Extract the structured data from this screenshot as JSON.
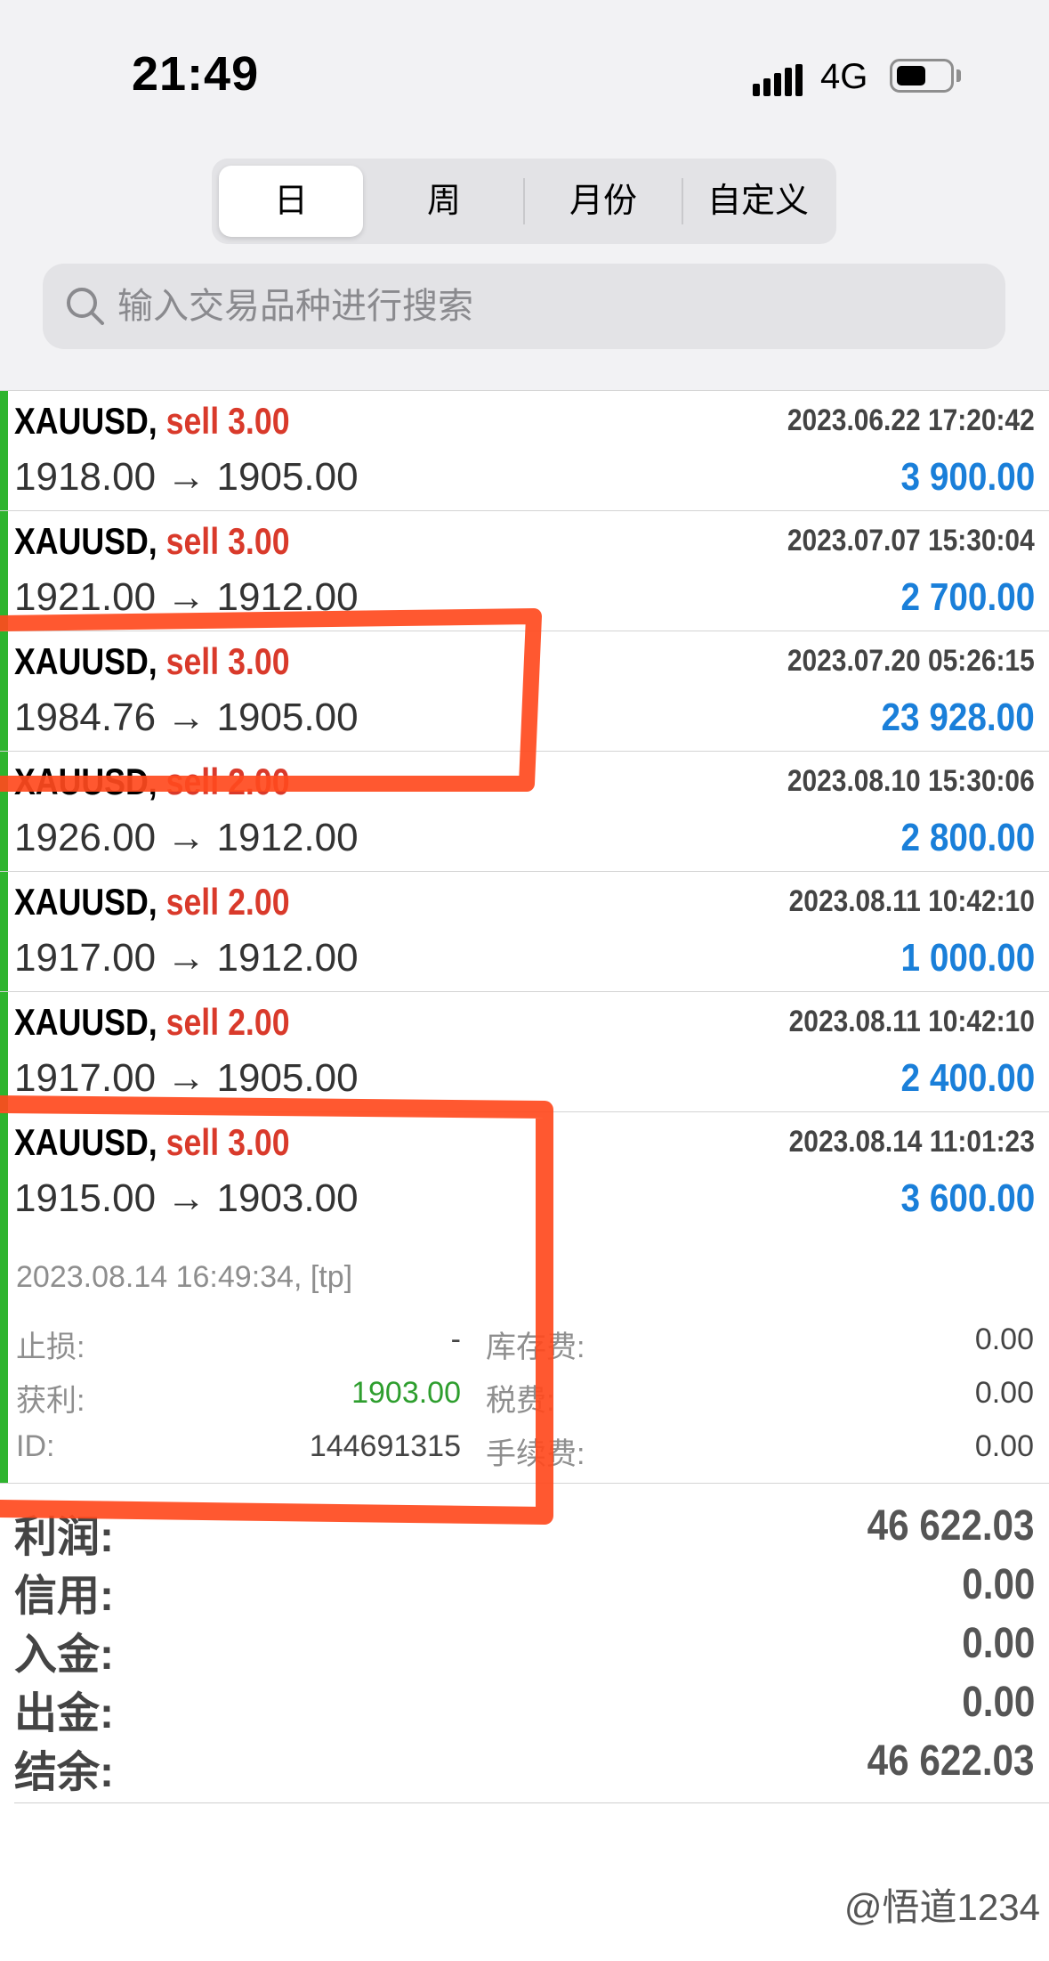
{
  "status_bar": {
    "time": "21:49",
    "network": "4G"
  },
  "tabs": [
    {
      "label": "日",
      "active": true
    },
    {
      "label": "周",
      "active": false
    },
    {
      "label": "月份",
      "active": false
    },
    {
      "label": "自定义",
      "active": false
    }
  ],
  "search": {
    "placeholder": "输入交易品种进行搜索"
  },
  "trades": [
    {
      "symbol": "XAUUSD,",
      "side": "sell 3.00",
      "time": "2023.06.22 17:20:42",
      "prices": "1918.00 → 1905.00",
      "profit": "3 900.00"
    },
    {
      "symbol": "XAUUSD,",
      "side": "sell 3.00",
      "time": "2023.07.07 15:30:04",
      "prices": "1921.00 → 1912.00",
      "profit": "2 700.00"
    },
    {
      "symbol": "XAUUSD,",
      "side": "sell 3.00",
      "time": "2023.07.20 05:26:15",
      "prices": "1984.76 → 1905.00",
      "profit": "23 928.00"
    },
    {
      "symbol": "XAUUSD,",
      "side": "sell 2.00",
      "time": "2023.08.10 15:30:06",
      "prices": "1926.00 → 1912.00",
      "profit": "2 800.00"
    },
    {
      "symbol": "XAUUSD,",
      "side": "sell 2.00",
      "time": "2023.08.11 10:42:10",
      "prices": "1917.00 → 1912.00",
      "profit": "1 000.00"
    },
    {
      "symbol": "XAUUSD,",
      "side": "sell 2.00",
      "time": "2023.08.11 10:42:10",
      "prices": "1917.00 → 1905.00",
      "profit": "2 400.00"
    },
    {
      "symbol": "XAUUSD,",
      "side": "sell 3.00",
      "time": "2023.08.14 11:01:23",
      "prices": "1915.00 → 1903.00",
      "profit": "3 600.00"
    }
  ],
  "expanded_details": {
    "close_info": "2023.08.14 16:49:34, [tp]",
    "stop_loss_label": "止损:",
    "stop_loss_value": "-",
    "take_profit_label": "获利:",
    "take_profit_value": "1903.00",
    "id_label": "ID:",
    "id_value": "144691315",
    "swap_label": "库存费:",
    "swap_value": "0.00",
    "tax_label": "税费:",
    "tax_value": "0.00",
    "commission_label": "手续费:",
    "commission_value": "0.00"
  },
  "summary": [
    {
      "label": "利润:",
      "value": "46 622.03"
    },
    {
      "label": "信用:",
      "value": "0.00"
    },
    {
      "label": "入金:",
      "value": "0.00"
    },
    {
      "label": "出金:",
      "value": "0.00"
    },
    {
      "label": "结余:",
      "value": "46 622.03"
    }
  ],
  "watermark": "@悟道1234",
  "colors": {
    "sell": "#d93a2b",
    "profit": "#1a7fd9",
    "take_profit": "#2e9e2e",
    "row_bar": "#2eb42e",
    "annotation_mark": "#ff4a1e"
  }
}
